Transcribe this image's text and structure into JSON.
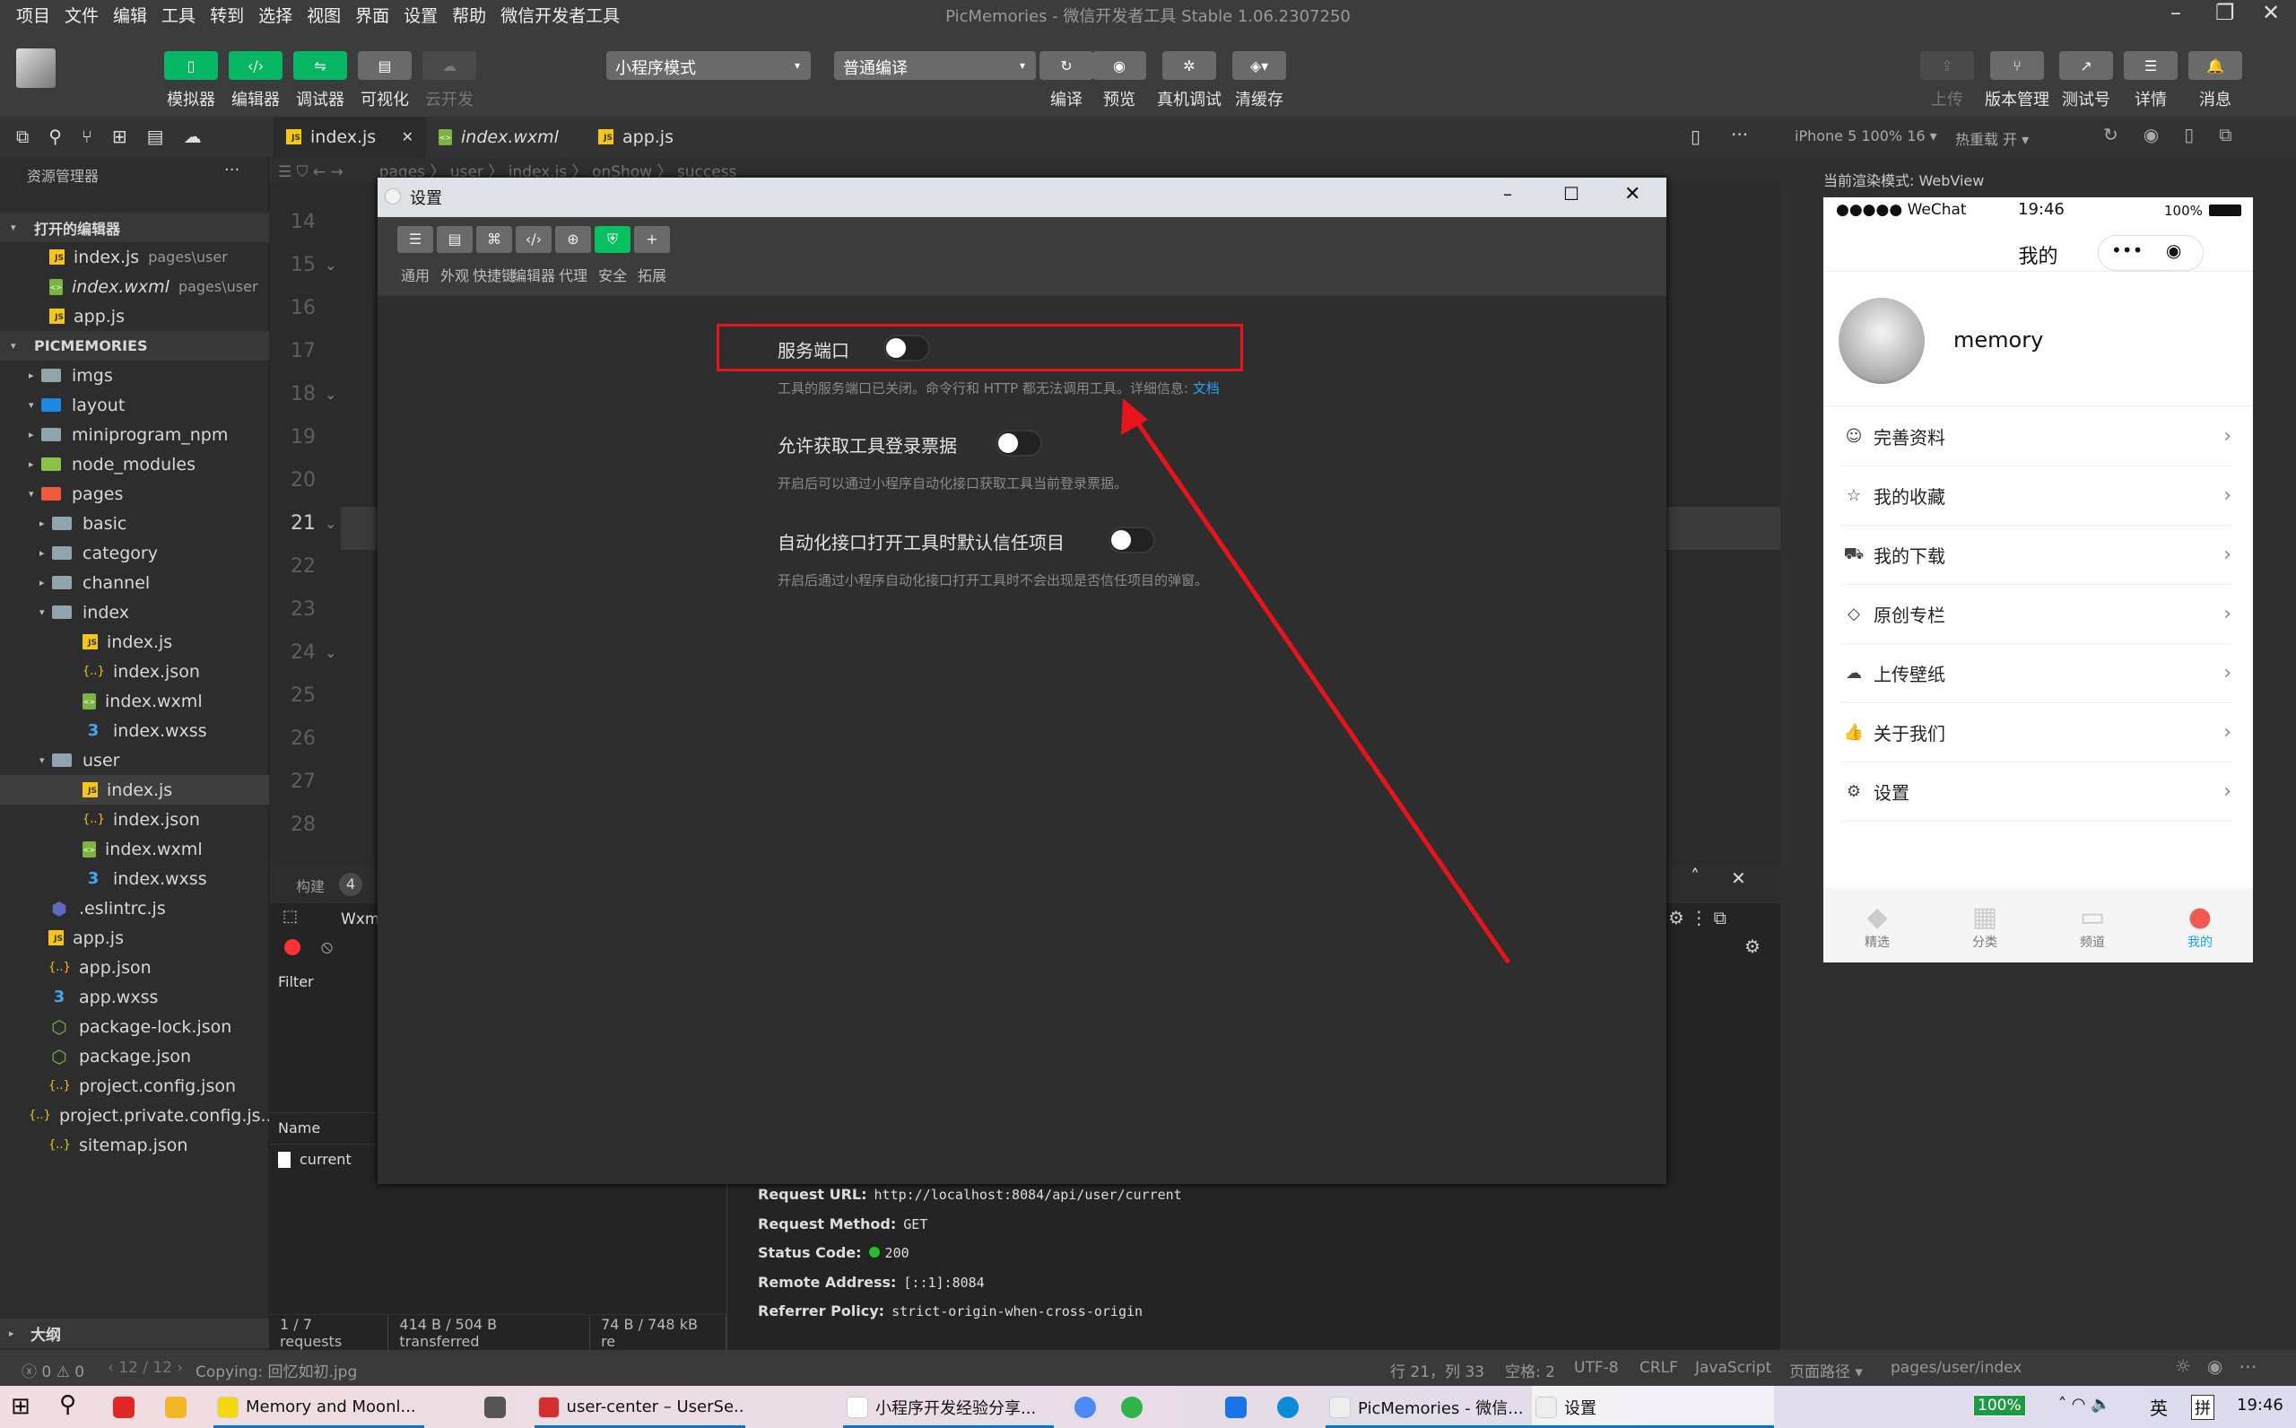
{
  "menu": [
    "项目",
    "文件",
    "编辑",
    "工具",
    "转到",
    "选择",
    "视图",
    "界面",
    "设置",
    "帮助",
    "微信开发者工具"
  ],
  "window_title": "PicMemories - 微信开发者工具 Stable 1.06.2307250",
  "toolbar": {
    "left": [
      {
        "label": "模拟器",
        "icon": "phone-icon"
      },
      {
        "label": "编辑器",
        "icon": "code-icon"
      },
      {
        "label": "调试器",
        "icon": "debug-icon"
      },
      {
        "label": "可视化",
        "icon": "layout-icon"
      },
      {
        "label": "云开发",
        "icon": "cloud-icon"
      }
    ],
    "mode_select": "小程序模式",
    "compile_select": "普通编译",
    "mid": [
      {
        "label": "编译",
        "icon": "refresh-icon"
      },
      {
        "label": "预览",
        "icon": "eye-icon"
      },
      {
        "label": "真机调试",
        "icon": "bug-icon"
      },
      {
        "label": "清缓存",
        "icon": "layers-icon"
      }
    ],
    "right": [
      {
        "label": "上传",
        "icon": "upload-icon"
      },
      {
        "label": "版本管理",
        "icon": "branch-icon"
      },
      {
        "label": "测试号",
        "icon": "external-icon"
      },
      {
        "label": "详情",
        "icon": "menu-icon"
      },
      {
        "label": "消息",
        "icon": "bell-icon"
      }
    ]
  },
  "tabs": [
    {
      "label": "index.js",
      "type": "js",
      "active": true
    },
    {
      "label": "index.wxml",
      "type": "wxml"
    },
    {
      "label": "app.js",
      "type": "js"
    }
  ],
  "breadcrumb": "pages 〉 user 〉 index.js 〉 onShow 〉 success",
  "sim_header": {
    "device": "iPhone 5 100% 16 ▾",
    "hotreload": "热重载 开 ▾"
  },
  "explorer": {
    "title": "资源管理器",
    "more": "···",
    "open_editors_heading": "打开的编辑器",
    "open_editors": [
      {
        "name": "index.js",
        "path": "pages\\user",
        "type": "js"
      },
      {
        "name": "index.wxml",
        "path": "pages\\user",
        "type": "wxml"
      },
      {
        "name": "app.js",
        "path": "",
        "type": "js"
      }
    ],
    "project_heading": "PICMEMORIES",
    "tree": [
      {
        "name": "imgs",
        "depth": 0,
        "type": "folder",
        "caret": "▸"
      },
      {
        "name": "layout",
        "depth": 0,
        "type": "folder-blue",
        "caret": "▾"
      },
      {
        "name": "miniprogram_npm",
        "depth": 0,
        "type": "folder",
        "caret": "▸"
      },
      {
        "name": "node_modules",
        "depth": 0,
        "type": "folder-green",
        "caret": "▸"
      },
      {
        "name": "pages",
        "depth": 0,
        "type": "folder-red",
        "caret": "▾"
      },
      {
        "name": "basic",
        "depth": 1,
        "type": "folder",
        "caret": "▸"
      },
      {
        "name": "category",
        "depth": 1,
        "type": "folder",
        "caret": "▸"
      },
      {
        "name": "channel",
        "depth": 1,
        "type": "folder",
        "caret": "▸"
      },
      {
        "name": "index",
        "depth": 1,
        "type": "folder",
        "caret": "▾"
      },
      {
        "name": "index.js",
        "depth": 2,
        "type": "js"
      },
      {
        "name": "index.json",
        "depth": 2,
        "type": "json"
      },
      {
        "name": "index.wxml",
        "depth": 2,
        "type": "wxml"
      },
      {
        "name": "index.wxss",
        "depth": 2,
        "type": "wxss"
      },
      {
        "name": "user",
        "depth": 1,
        "type": "folder",
        "caret": "▾"
      },
      {
        "name": "index.js",
        "depth": 2,
        "type": "js",
        "active": true
      },
      {
        "name": "index.json",
        "depth": 2,
        "type": "json"
      },
      {
        "name": "index.wxml",
        "depth": 2,
        "type": "wxml"
      },
      {
        "name": "index.wxss",
        "depth": 2,
        "type": "wxss"
      },
      {
        "name": ".eslintrc.js",
        "depth": 0,
        "type": "eslint"
      },
      {
        "name": "app.js",
        "depth": 0,
        "type": "js"
      },
      {
        "name": "app.json",
        "depth": 0,
        "type": "json"
      },
      {
        "name": "app.wxss",
        "depth": 0,
        "type": "wxss"
      },
      {
        "name": "package-lock.json",
        "depth": 0,
        "type": "node"
      },
      {
        "name": "package.json",
        "depth": 0,
        "type": "node"
      },
      {
        "name": "project.config.json",
        "depth": 0,
        "type": "json"
      },
      {
        "name": "project.private.config.js...",
        "depth": 0,
        "type": "json"
      },
      {
        "name": "sitemap.json",
        "depth": 0,
        "type": "json"
      }
    ],
    "outline": "大纲"
  },
  "line_numbers": [
    "14",
    "15",
    "16",
    "17",
    "18",
    "19",
    "20",
    "21",
    "22",
    "23",
    "24",
    "25",
    "26",
    "27",
    "28"
  ],
  "dialog": {
    "title": "设置",
    "tabs": [
      {
        "label": "通用",
        "icon": "sliders-icon"
      },
      {
        "label": "外观",
        "icon": "window-icon"
      },
      {
        "label": "快捷键",
        "icon": "command-icon"
      },
      {
        "label": "编辑器",
        "icon": "code-icon"
      },
      {
        "label": "代理",
        "icon": "globe-icon"
      },
      {
        "label": "安全",
        "icon": "shield-icon",
        "active": true
      },
      {
        "label": "拓展",
        "icon": "plus-icon"
      }
    ],
    "settings": [
      {
        "label": "服务端口",
        "on": false,
        "desc": "工具的服务端口已关闭。命令行和 HTTP 都无法调用工具。详细信息: ",
        "link": "文档"
      },
      {
        "label": "允许获取工具登录票据",
        "on": false,
        "desc": "开启后可以通过小程序自动化接口获取工具当前登录票据。"
      },
      {
        "label": "自动化接口打开工具时默认信任项目",
        "on": false,
        "desc": "开启后通过小程序自动化接口打开工具时不会出现是否信任项目的弹窗。"
      }
    ],
    "annotation_color": "#e8141c"
  },
  "devtools": {
    "build_label": "构建",
    "build_count": "4",
    "panel_tab": "Wxm",
    "filter": "Filter",
    "name_col": "Name",
    "request": "current",
    "summary": [
      "1 / 7 requests",
      "414 B / 504 B transferred",
      "74 B / 748 kB re"
    ],
    "details": [
      {
        "k": "Request URL:",
        "v": "http://localhost:8084/api/user/current"
      },
      {
        "k": "Request Method:",
        "v": "GET"
      },
      {
        "k": "Status Code:",
        "v": "200",
        "dot": "#22c02a"
      },
      {
        "k": "Remote Address:",
        "v": "[::1]:8084"
      },
      {
        "k": "Referrer Policy:",
        "v": "strict-origin-when-cross-origin"
      }
    ]
  },
  "simulator": {
    "render_mode": "当前渲染模式: WebView",
    "status": {
      "carrier": "●●●●● WeChat",
      "time": "19:46",
      "battery": "100%"
    },
    "nav_title": "我的",
    "username": "memory",
    "menu": [
      {
        "label": "完善资料",
        "icon": "user-circle-icon"
      },
      {
        "label": "我的收藏",
        "icon": "star-icon"
      },
      {
        "label": "我的下载",
        "icon": "cart-icon"
      },
      {
        "label": "原创专栏",
        "icon": "diamond-icon"
      },
      {
        "label": "上传壁纸",
        "icon": "cloud-upload-icon"
      },
      {
        "label": "关于我们",
        "icon": "thumbs-up-icon"
      },
      {
        "label": "设置",
        "icon": "gear-icon"
      }
    ],
    "tabbar": [
      {
        "label": "精选"
      },
      {
        "label": "分类"
      },
      {
        "label": "频道"
      },
      {
        "label": "我的",
        "active": true
      }
    ],
    "accent": "#1aa0e6"
  },
  "statusbar": {
    "errors": "0",
    "warnings": "0",
    "pager": "12 / 12",
    "message": "Copying: 回忆如初.jpg",
    "position": "行 21，列 33",
    "indent": "空格: 2",
    "encoding": "UTF-8",
    "eol": "CRLF",
    "language": "JavaScript",
    "page_path_label": "页面路径 ▾",
    "page_path": "pages/user/index"
  },
  "taskbar": {
    "items": [
      "Memory and Moonl...",
      "user-center – UserSe...",
      "小程序开发经验分享...",
      "PicMemories - 微信...",
      "设置"
    ],
    "battery": "100%",
    "ime": "英",
    "ime2": "拼",
    "clock": "19:46"
  }
}
